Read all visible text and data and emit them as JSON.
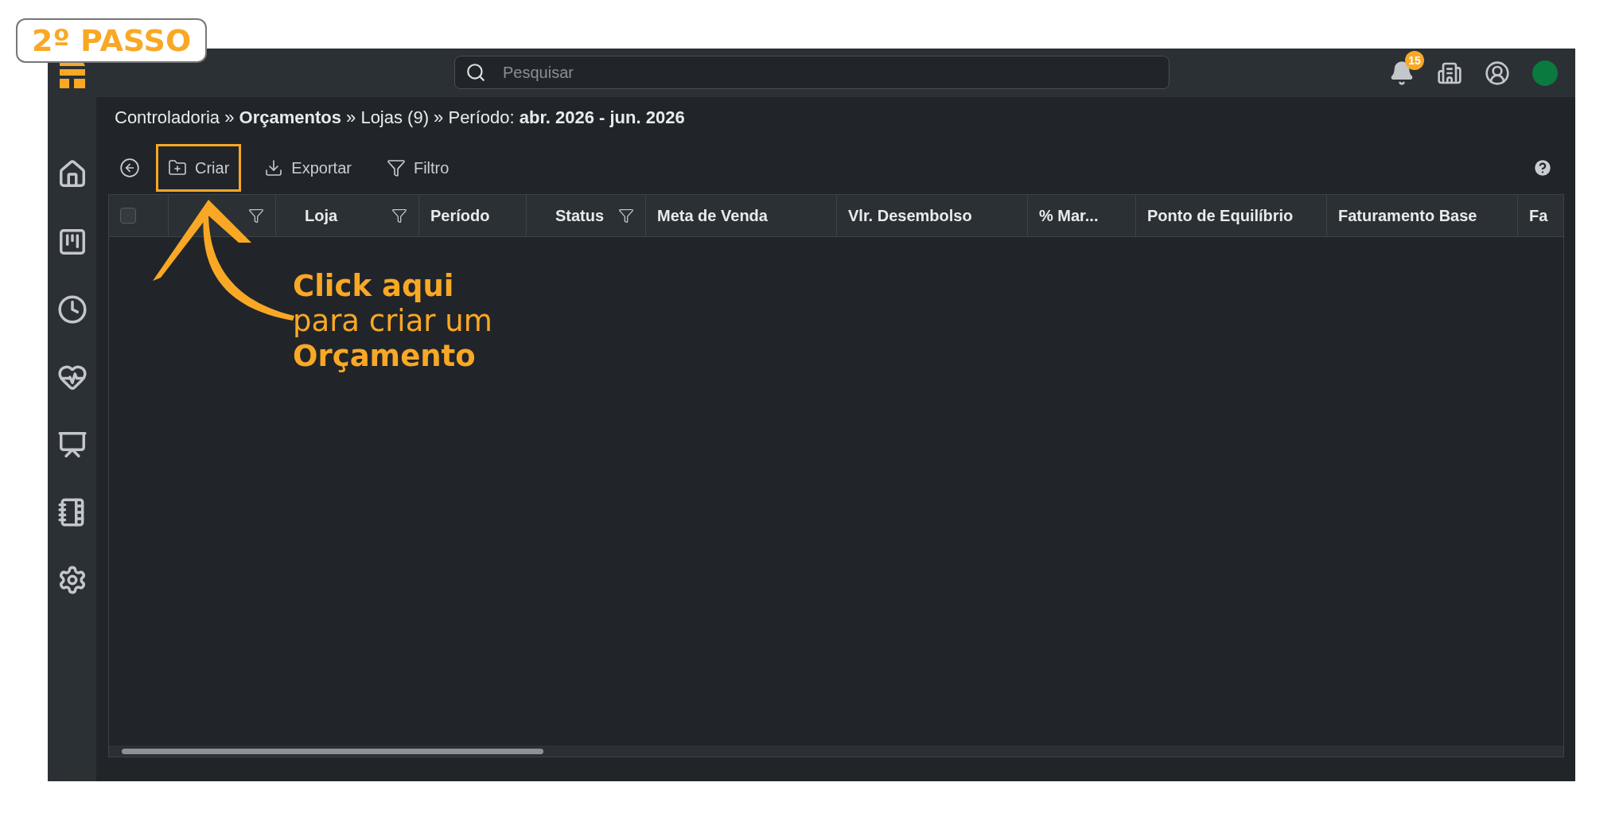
{
  "badge": {
    "label": "2º PASSO"
  },
  "search": {
    "placeholder": "Pesquisar"
  },
  "notifications": {
    "count": "15"
  },
  "sidebar": {
    "items": [
      {
        "kind": "home"
      },
      {
        "kind": "board"
      },
      {
        "kind": "clock"
      },
      {
        "kind": "health"
      },
      {
        "kind": "easel"
      },
      {
        "kind": "notebook"
      },
      {
        "kind": "settings"
      }
    ]
  },
  "breadcrumb": "Controladoria » **Orçamentos** » Lojas (9) » Período: **abr. 2026 - jun. 2026**",
  "toolbar": [
    {
      "kind": "back"
    },
    {
      "kind": "create",
      "label": "Criar",
      "highlighted": true
    },
    {
      "kind": "export",
      "label": "Exportar",
      "highlighted": false
    },
    {
      "kind": "filter",
      "label": "Filtro",
      "highlighted": false
    }
  ],
  "table": {
    "select_all": {
      "checked": false
    },
    "columns": [
      {
        "filter": true
      },
      {
        "label": "Loja",
        "filter": true
      },
      {
        "label": "Período",
        "filter": false
      },
      {
        "label": "Status",
        "filter": true
      },
      {
        "label": "Meta de Venda",
        "filter": false
      },
      {
        "label": "Vlr. Desembolso",
        "filter": false
      },
      {
        "label": "% Mar...",
        "filter": false
      },
      {
        "label": "Ponto de Equilíbrio",
        "filter": false
      },
      {
        "label": "Faturamento Base",
        "filter": false
      },
      {
        "label": "Fa",
        "filter": false
      }
    ]
  },
  "annotation": {
    "text": "**Click aqui**\npara criar um\n**Orçamento**"
  }
}
